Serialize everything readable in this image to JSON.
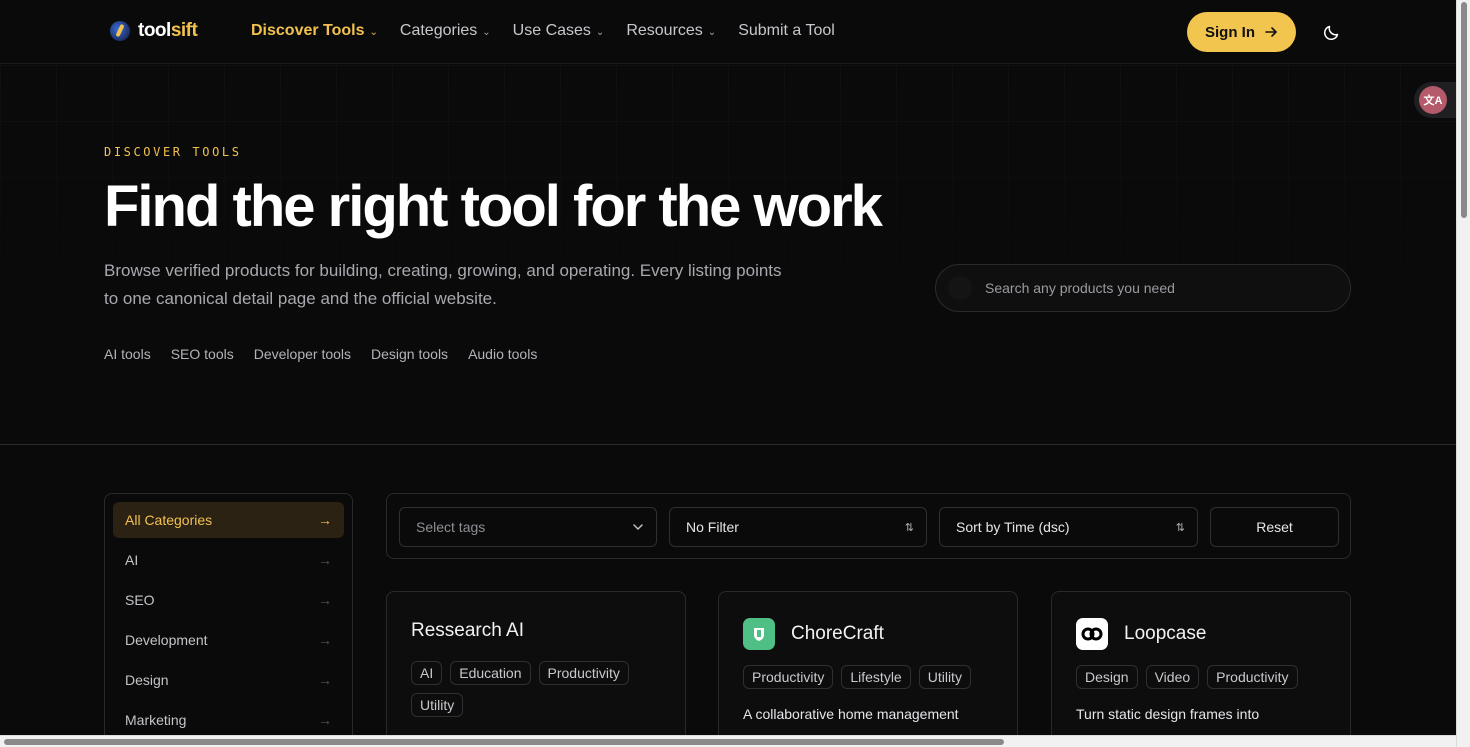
{
  "brand": {
    "name_part1": "tool",
    "name_part2": "sift",
    "accent": "#f2c14e"
  },
  "nav": {
    "links": [
      {
        "label": "Discover Tools",
        "dropdown": true,
        "active": true
      },
      {
        "label": "Categories",
        "dropdown": true
      },
      {
        "label": "Use Cases",
        "dropdown": true
      },
      {
        "label": "Resources",
        "dropdown": true
      },
      {
        "label": "Submit a Tool",
        "dropdown": false
      }
    ],
    "signin_label": "Sign In",
    "theme_icon": "moon-icon"
  },
  "hero": {
    "eyebrow": "DISCOVER TOOLS",
    "title": "Find the right tool for the work",
    "subtitle": "Browse verified products for building, creating, growing, and operating. Every listing points to one canonical detail page and the official website.",
    "quick_links": [
      "AI tools",
      "SEO tools",
      "Developer tools",
      "Design tools",
      "Audio tools"
    ],
    "search_placeholder": "Search any products you need"
  },
  "sidebar": {
    "categories": [
      {
        "label": "All Categories",
        "active": true
      },
      {
        "label": "AI"
      },
      {
        "label": "SEO"
      },
      {
        "label": "Development"
      },
      {
        "label": "Design"
      },
      {
        "label": "Marketing"
      }
    ]
  },
  "filters": {
    "tags_placeholder": "Select tags",
    "filter_value": "No Filter",
    "sort_value": "Sort by Time (dsc)",
    "reset_label": "Reset"
  },
  "cards": [
    {
      "title": "Ressearch AI",
      "tags": [
        "AI",
        "Education",
        "Productivity",
        "Utility"
      ],
      "description": ""
    },
    {
      "title": "ChoreCraft",
      "tags": [
        "Productivity",
        "Lifestyle",
        "Utility"
      ],
      "description": "A collaborative home management",
      "logo_color": "#4fbf86"
    },
    {
      "title": "Loopcase",
      "tags": [
        "Design",
        "Video",
        "Productivity"
      ],
      "description": "Turn static design frames into",
      "logo_color": "#ffffff"
    }
  ]
}
